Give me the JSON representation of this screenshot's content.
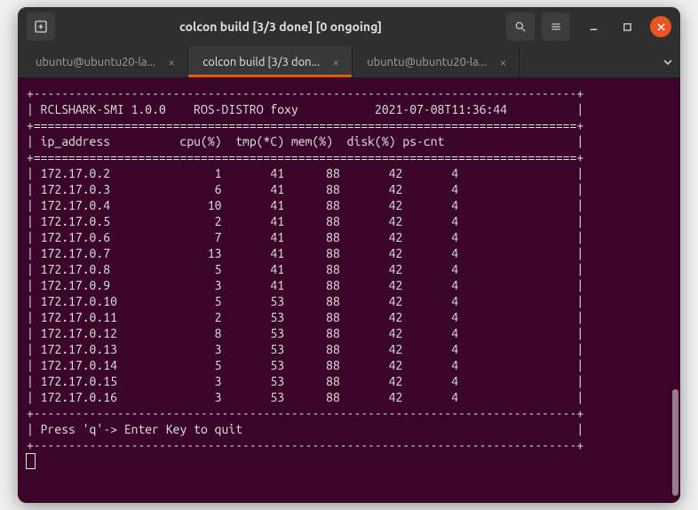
{
  "window": {
    "title": "colcon build [3/3 done] [0 ongoing]"
  },
  "tabs": [
    {
      "label": "ubuntu@ubuntu20-la...",
      "active": false
    },
    {
      "label": "colcon build [3/3 don...",
      "active": true
    },
    {
      "label": "ubuntu@ubuntu20-la...",
      "active": false
    }
  ],
  "smi": {
    "app": "RCLSHARK-SMI",
    "version": "1.0.0",
    "distro_label": "ROS-DISTRO",
    "distro": "foxy",
    "timestamp": "2021-07-08T11:36:44",
    "columns": [
      "ip_address",
      "cpu(%)",
      "tmp(*C)",
      "mem(%)",
      "disk(%)",
      "ps-cnt"
    ],
    "rows": [
      {
        "ip": "172.17.0.2",
        "cpu": 1,
        "tmp": 41,
        "mem": 88,
        "disk": 42,
        "ps": 4
      },
      {
        "ip": "172.17.0.3",
        "cpu": 6,
        "tmp": 41,
        "mem": 88,
        "disk": 42,
        "ps": 4
      },
      {
        "ip": "172.17.0.4",
        "cpu": 10,
        "tmp": 41,
        "mem": 88,
        "disk": 42,
        "ps": 4
      },
      {
        "ip": "172.17.0.5",
        "cpu": 2,
        "tmp": 41,
        "mem": 88,
        "disk": 42,
        "ps": 4
      },
      {
        "ip": "172.17.0.6",
        "cpu": 7,
        "tmp": 41,
        "mem": 88,
        "disk": 42,
        "ps": 4
      },
      {
        "ip": "172.17.0.7",
        "cpu": 13,
        "tmp": 41,
        "mem": 88,
        "disk": 42,
        "ps": 4
      },
      {
        "ip": "172.17.0.8",
        "cpu": 5,
        "tmp": 41,
        "mem": 88,
        "disk": 42,
        "ps": 4
      },
      {
        "ip": "172.17.0.9",
        "cpu": 3,
        "tmp": 41,
        "mem": 88,
        "disk": 42,
        "ps": 4
      },
      {
        "ip": "172.17.0.10",
        "cpu": 5,
        "tmp": 53,
        "mem": 88,
        "disk": 42,
        "ps": 4
      },
      {
        "ip": "172.17.0.11",
        "cpu": 2,
        "tmp": 53,
        "mem": 88,
        "disk": 42,
        "ps": 4
      },
      {
        "ip": "172.17.0.12",
        "cpu": 8,
        "tmp": 53,
        "mem": 88,
        "disk": 42,
        "ps": 4
      },
      {
        "ip": "172.17.0.13",
        "cpu": 3,
        "tmp": 53,
        "mem": 88,
        "disk": 42,
        "ps": 4
      },
      {
        "ip": "172.17.0.14",
        "cpu": 5,
        "tmp": 53,
        "mem": 88,
        "disk": 42,
        "ps": 4
      },
      {
        "ip": "172.17.0.15",
        "cpu": 3,
        "tmp": 53,
        "mem": 88,
        "disk": 42,
        "ps": 4
      },
      {
        "ip": "172.17.0.16",
        "cpu": 3,
        "tmp": 53,
        "mem": 88,
        "disk": 42,
        "ps": 4
      }
    ],
    "footer": "Press 'q'-> Enter Key to quit"
  }
}
